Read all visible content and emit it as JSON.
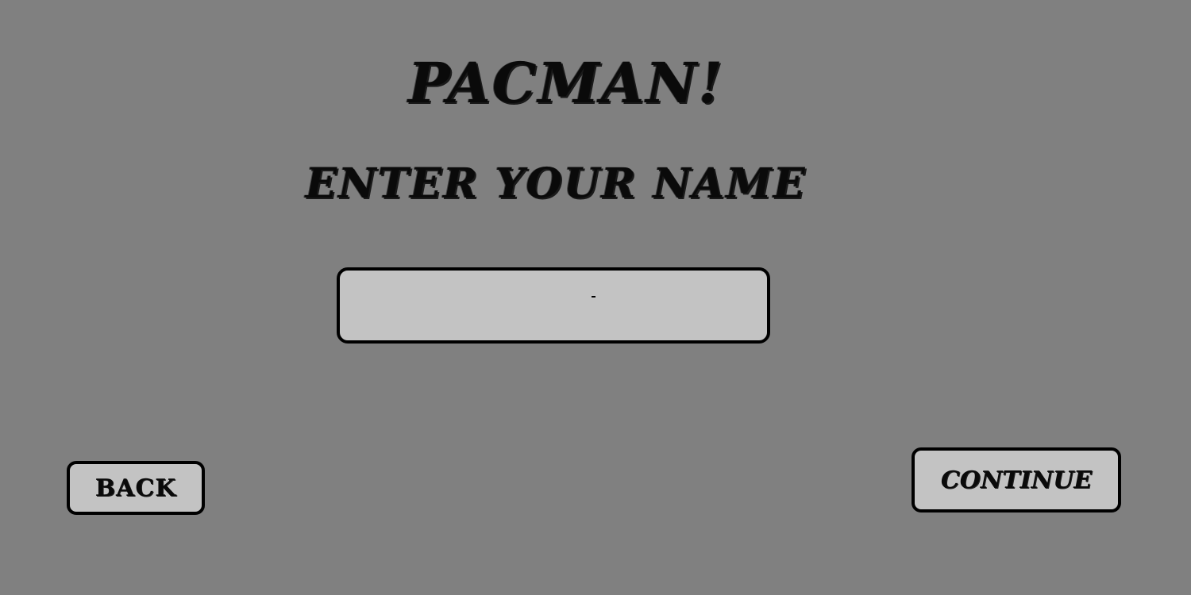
{
  "screen": {
    "title": "PACMAN!",
    "subtitle": "ENTER YOUR NAME"
  },
  "name_input": {
    "value": "",
    "placeholder": ""
  },
  "buttons": {
    "back_label": "BACK",
    "continue_label": "CONTINUE"
  },
  "colors": {
    "background": "#808080",
    "panel": "#c3c3c3",
    "border": "#000000",
    "text": "#0a0a0a"
  }
}
